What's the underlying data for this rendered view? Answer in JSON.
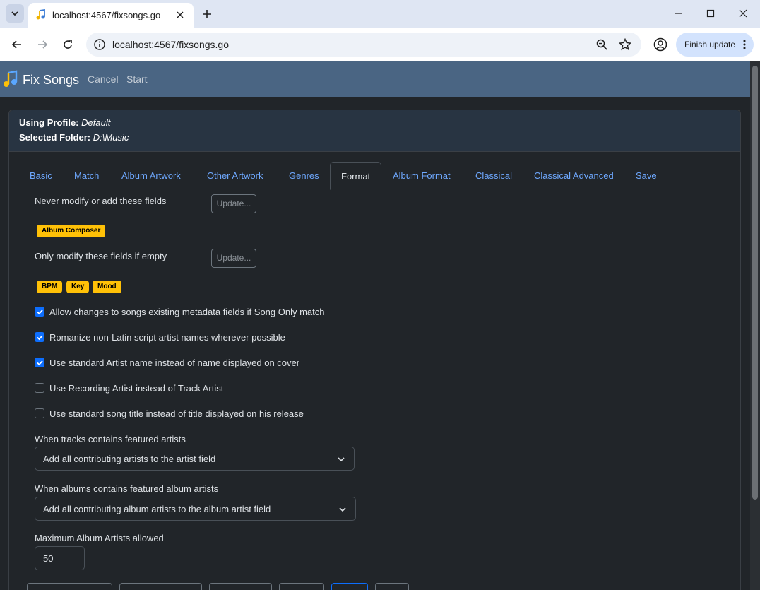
{
  "browser": {
    "tab_title": "localhost:4567/fixsongs.go",
    "url": "localhost:4567/fixsongs.go",
    "finish_update_label": "Finish update"
  },
  "app": {
    "brand": "Fix Songs",
    "nav": {
      "cancel": "Cancel",
      "start": "Start"
    }
  },
  "header": {
    "profile_label": "Using Profile:",
    "profile_value": "Default",
    "folder_label": "Selected Folder:",
    "folder_value": "D:\\Music"
  },
  "tabs": [
    "Basic",
    "Match",
    "Album Artwork",
    "Other Artwork",
    "Genres",
    "Format",
    "Album Format",
    "Classical",
    "Classical Advanced",
    "Save"
  ],
  "active_tab": "Format",
  "format": {
    "never_modify_label": "Never modify or add these fields",
    "never_modify_button": "Update...",
    "never_modify_fields": [
      "Album Composer"
    ],
    "only_if_empty_label": "Only modify these fields if empty",
    "only_if_empty_button": "Update...",
    "only_if_empty_fields": [
      "BPM",
      "Key",
      "Mood"
    ],
    "checkboxes": [
      {
        "label": "Allow changes to songs existing metadata fields if Song Only match",
        "checked": true
      },
      {
        "label": "Romanize non-Latin script artist names wherever possible",
        "checked": true
      },
      {
        "label": "Use standard Artist name instead of name displayed on cover",
        "checked": true
      },
      {
        "label": "Use Recording Artist instead of Track Artist",
        "checked": false
      },
      {
        "label": "Use standard song title instead of title displayed on his release",
        "checked": false
      }
    ],
    "featured_artists_label": "When tracks contains featured artists",
    "featured_artists_value": "Add all contributing artists to the artist field",
    "featured_album_artists_label": "When albums contains featured album artists",
    "featured_album_artists_value": "Add all contributing album artists to the album artist field",
    "max_album_artists_label": "Maximum Album Artists allowed",
    "max_album_artists_value": "50"
  },
  "colors": {
    "appbar": "#4a6583",
    "page_bg": "#212529",
    "badge": "#ffc107",
    "link": "#6ea8fe",
    "check": "#0d6efd"
  }
}
